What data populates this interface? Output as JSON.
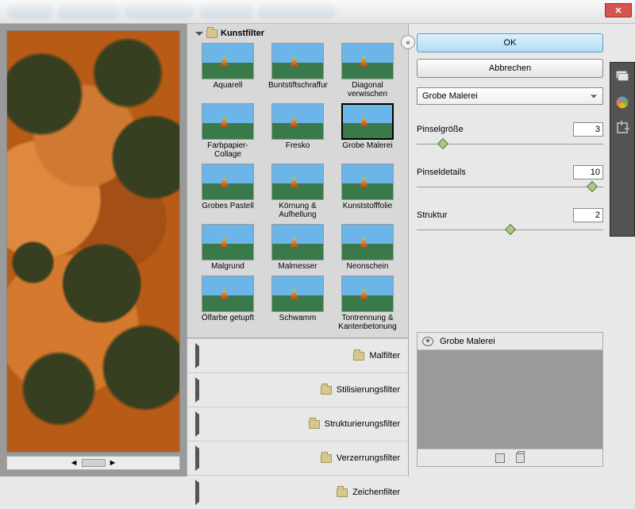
{
  "buttons": {
    "ok": "OK",
    "cancel": "Abbrechen"
  },
  "category_open": "Kunstfilter",
  "filters": [
    "Aquarell",
    "Buntstiftschraffur",
    "Diagonal verwischen",
    "Farbpapier-Collage",
    "Fresko",
    "Grobe Malerei",
    "Grobes Pastell",
    "Körnung & Aufhellung",
    "Kunststofffolie",
    "Malgrund",
    "Malmesser",
    "Neonschein",
    "Ölfarbe getupft",
    "Schwamm",
    "Tontrennung & Kantenbetonung"
  ],
  "selected_filter": "Grobe Malerei",
  "categories_closed": [
    "Malfilter",
    "Stilisierungsfilter",
    "Strukturierungsfilter",
    "Verzerrungsfilter",
    "Zeichenfilter"
  ],
  "params": {
    "p1_label": "Pinselgröße",
    "p1_value": "3",
    "p2_label": "Pinseldetails",
    "p2_value": "10",
    "p3_label": "Struktur",
    "p3_value": "2"
  },
  "layer_name": "Grobe Malerei"
}
